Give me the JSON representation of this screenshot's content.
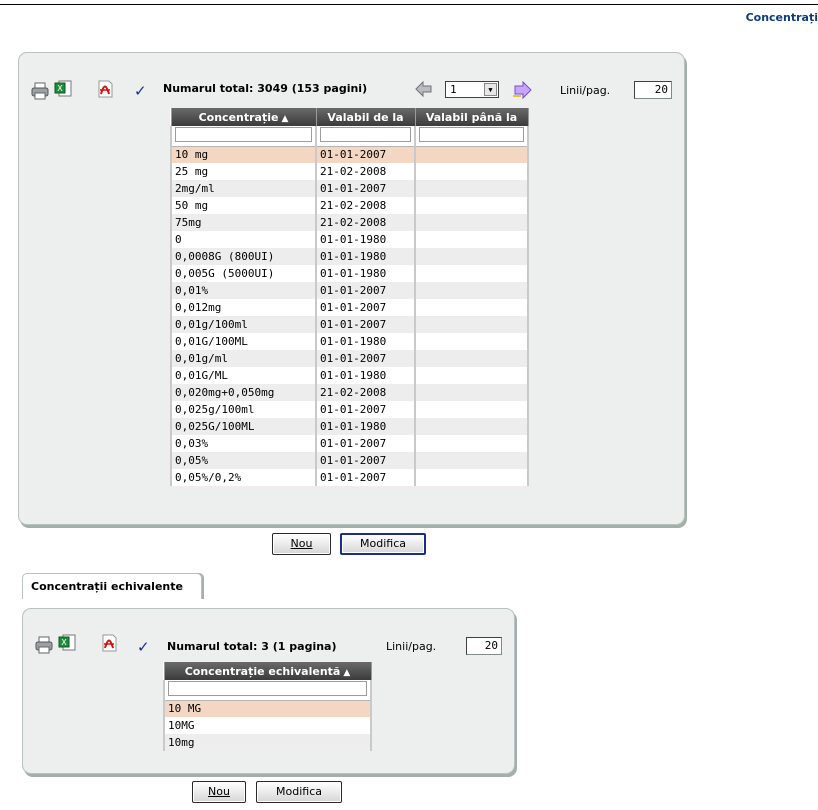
{
  "header": {
    "title": "Concentrați"
  },
  "main_grid": {
    "total_text": "Numarul total: 3049 (153 pagini)",
    "page_value": "1",
    "lines_label": "Linii/pag.",
    "lines_value": "20",
    "columns": [
      "Concentrație",
      "Valabil de la",
      "Valabil până la"
    ],
    "rows": [
      [
        "10 mg",
        "01-01-2007",
        ""
      ],
      [
        "25 mg",
        "21-02-2008",
        ""
      ],
      [
        "2mg/ml",
        "01-01-2007",
        ""
      ],
      [
        "50 mg",
        "21-02-2008",
        ""
      ],
      [
        "75mg",
        "21-02-2008",
        ""
      ],
      [
        "0",
        "01-01-1980",
        ""
      ],
      [
        "0,0008G (800UI)",
        "01-01-1980",
        ""
      ],
      [
        "0,005G (5000UI)",
        "01-01-1980",
        ""
      ],
      [
        "0,01%",
        "01-01-2007",
        ""
      ],
      [
        "0,012mg",
        "01-01-2007",
        ""
      ],
      [
        "0,01g/100ml",
        "01-01-2007",
        ""
      ],
      [
        "0,01G/100ML",
        "01-01-1980",
        ""
      ],
      [
        "0,01g/ml",
        "01-01-2007",
        ""
      ],
      [
        "0,01G/ML",
        "01-01-1980",
        ""
      ],
      [
        "0,020mg+0,050mg",
        "21-02-2008",
        ""
      ],
      [
        "0,025g/100ml",
        "01-01-2007",
        ""
      ],
      [
        "0,025G/100ML",
        "01-01-1980",
        ""
      ],
      [
        "0,03%",
        "01-01-2007",
        ""
      ],
      [
        "0,05%",
        "01-01-2007",
        ""
      ],
      [
        "0,05%/0,2%",
        "01-01-2007",
        ""
      ]
    ],
    "buttons": {
      "new": "Nou",
      "modify": "Modifica"
    }
  },
  "tab": {
    "label": "Concentrații echivalente"
  },
  "equiv_grid": {
    "total_text": "Numarul total: 3 (1 pagina)",
    "lines_label": "Linii/pag.",
    "lines_value": "20",
    "columns": [
      "Concentrație echivalentă"
    ],
    "rows": [
      [
        "10 MG"
      ],
      [
        "10MG"
      ],
      [
        "10mg"
      ]
    ],
    "buttons": {
      "new": "Nou",
      "modify": "Modifica"
    }
  },
  "icons": [
    "print-icon",
    "excel-icon",
    "pdf-icon",
    "check-icon",
    "prev-page-icon",
    "next-page-icon",
    "sort-asc-icon"
  ]
}
